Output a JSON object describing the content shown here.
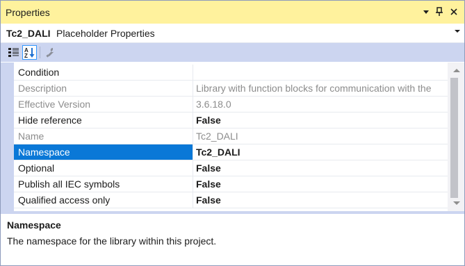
{
  "window": {
    "title": "Properties",
    "buttons": [
      "dropdown-arrow-icon",
      "pin-icon",
      "close-icon"
    ]
  },
  "object_selector": {
    "name": "Tc2_DALI",
    "type": "Placeholder Properties"
  },
  "toolbar": {
    "tools": [
      "categorized-icon",
      "alphabetical-icon",
      "property-pages-icon"
    ],
    "active_tool": "alphabetical-icon"
  },
  "properties": [
    {
      "name": "Condition",
      "value": "",
      "readonly": false,
      "bold": false
    },
    {
      "name": "Description",
      "value": "Library with function blocks for communication with the",
      "readonly": true,
      "bold": false
    },
    {
      "name": "Effective Version",
      "value": "3.6.18.0",
      "readonly": true,
      "bold": false
    },
    {
      "name": "Hide reference",
      "value": "False",
      "readonly": false,
      "bold": true
    },
    {
      "name": "Name",
      "value": "Tc2_DALI",
      "readonly": true,
      "bold": false
    },
    {
      "name": "Namespace",
      "value": "Tc2_DALI",
      "readonly": false,
      "bold": true,
      "selected": true
    },
    {
      "name": "Optional",
      "value": "False",
      "readonly": false,
      "bold": true
    },
    {
      "name": "Publish all IEC symbols",
      "value": "False",
      "readonly": false,
      "bold": true
    },
    {
      "name": "Qualified access only",
      "value": "False",
      "readonly": false,
      "bold": true
    }
  ],
  "description_pane": {
    "title": "Namespace",
    "text": "The namespace for the library within this project."
  },
  "colors": {
    "title_bar": "#fff29d",
    "toolbar": "#ccd5f0",
    "selection": "#0a78d7",
    "readonly_text": "#8c8c8c"
  }
}
